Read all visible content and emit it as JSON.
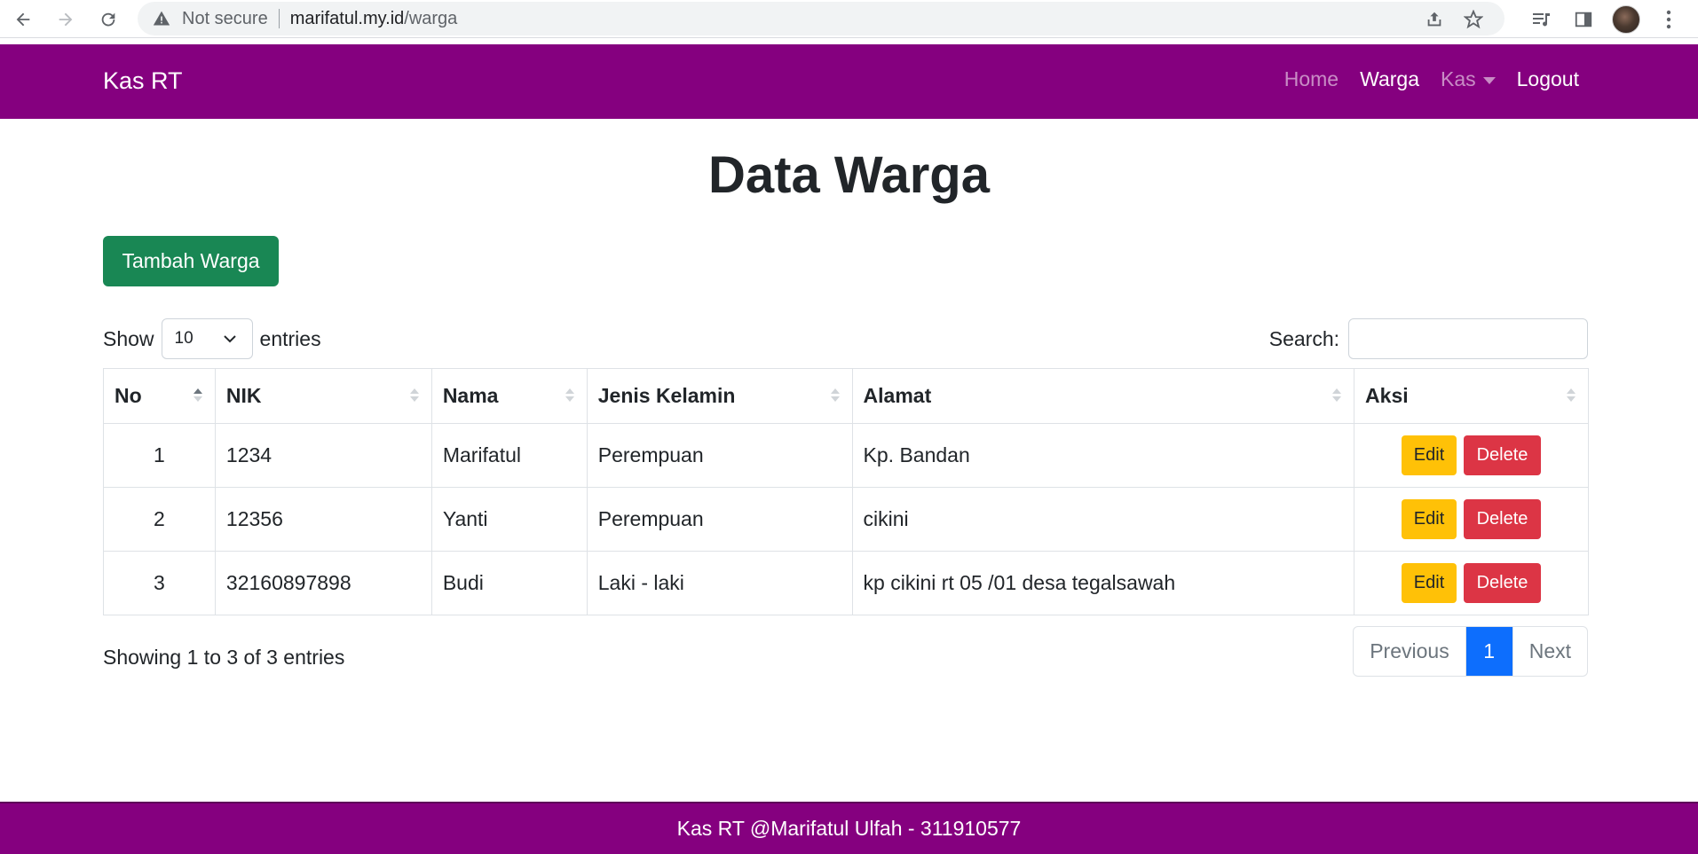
{
  "browser": {
    "security_label": "Not secure",
    "url_host": "marifatul.my.id",
    "url_path": "/warga"
  },
  "navbar": {
    "brand": "Kas RT",
    "links": [
      {
        "label": "Home",
        "active": false
      },
      {
        "label": "Warga",
        "active": true
      },
      {
        "label": "Kas",
        "active": false,
        "dropdown": true
      },
      {
        "label": "Logout",
        "active": true
      }
    ],
    "color": "#85007f"
  },
  "page": {
    "title": "Data Warga",
    "add_button": "Tambah Warga"
  },
  "table_controls": {
    "show_label": "Show",
    "entries_value": "10",
    "entries_label": "entries",
    "search_label": "Search:",
    "search_value": ""
  },
  "table": {
    "headers": [
      "No",
      "NIK",
      "Nama",
      "Jenis Kelamin",
      "Alamat",
      "Aksi"
    ],
    "rows": [
      {
        "no": "1",
        "nik": "1234",
        "nama": "Marifatul",
        "jk": "Perempuan",
        "alamat": "Kp. Bandan"
      },
      {
        "no": "2",
        "nik": "12356",
        "nama": "Yanti",
        "jk": "Perempuan",
        "alamat": "cikini"
      },
      {
        "no": "3",
        "nik": "32160897898",
        "nama": "Budi",
        "jk": "Laki - laki",
        "alamat": "kp cikini rt 05 /01 desa tegalsawah"
      }
    ],
    "edit_label": "Edit",
    "delete_label": "Delete"
  },
  "pagination": {
    "info": "Showing 1 to 3 of 3 entries",
    "previous": "Previous",
    "current": "1",
    "next": "Next"
  },
  "footer": {
    "text": "Kas RT @Marifatul Ulfah - 311910577"
  },
  "colors": {
    "success": "#198754",
    "warning": "#ffc107",
    "danger": "#dc3545",
    "primary": "#0d6efd"
  }
}
